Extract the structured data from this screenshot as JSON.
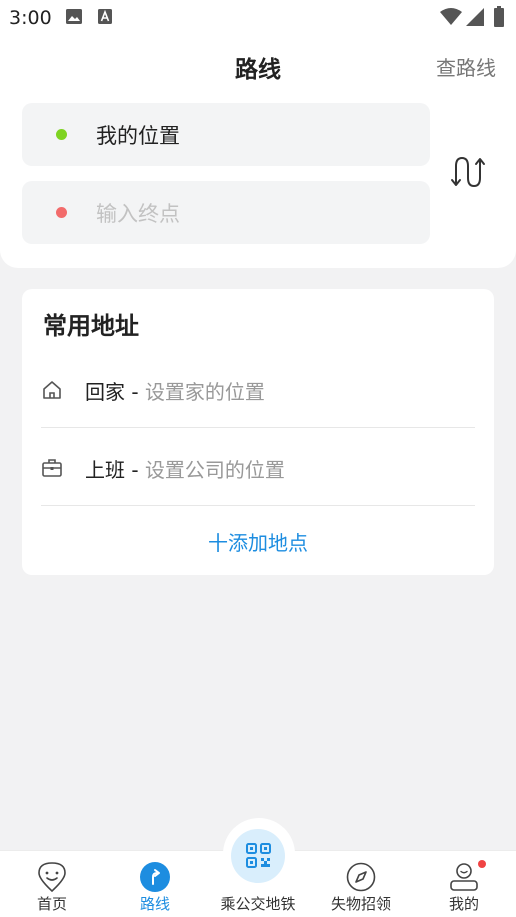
{
  "status_bar": {
    "time": "3:00"
  },
  "header": {
    "title": "路线",
    "right_link": "查路线"
  },
  "route_inputs": {
    "start_value": "我的位置",
    "end_placeholder": "输入终点"
  },
  "common_addresses": {
    "title": "常用地址",
    "items": [
      {
        "name": "回家",
        "separator": " - ",
        "hint": "设置家的位置",
        "icon": "home-icon"
      },
      {
        "name": "上班",
        "separator": " - ",
        "hint": "设置公司的位置",
        "icon": "briefcase-icon"
      }
    ],
    "add_label": "十添加地点"
  },
  "bottom_nav": {
    "items": [
      {
        "label": "首页",
        "icon": "home-face-icon"
      },
      {
        "label": "路线",
        "icon": "route-icon"
      },
      {
        "label": "乘公交地铁",
        "icon": "qr-code-icon"
      },
      {
        "label": "失物招领",
        "icon": "compass-icon"
      },
      {
        "label": "我的",
        "icon": "profile-icon"
      }
    ],
    "active_index": 1
  },
  "colors": {
    "accent": "#1d8de0",
    "start_dot": "#7ed321",
    "end_dot": "#f26b6b",
    "badge": "#f04343"
  }
}
